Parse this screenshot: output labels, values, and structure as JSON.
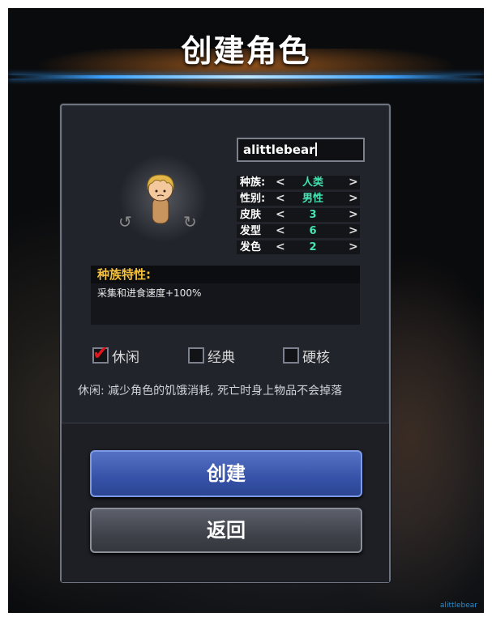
{
  "title": "创建角色",
  "character": {
    "name": "alittlebear",
    "attributes": [
      {
        "label": "种族:",
        "value": "人类"
      },
      {
        "label": "性别:",
        "value": "男性"
      },
      {
        "label": "皮肤",
        "value": "3"
      },
      {
        "label": "发型",
        "value": "6"
      },
      {
        "label": "发色",
        "value": "2"
      }
    ]
  },
  "trait": {
    "heading": "种族特性:",
    "description": "采集和进食速度+100%"
  },
  "modes": [
    {
      "label": "休闲",
      "checked": true
    },
    {
      "label": "经典",
      "checked": false
    },
    {
      "label": "硬核",
      "checked": false
    }
  ],
  "mode_description": "休闲: 减少角色的饥饿消耗, 死亡时身上物品不会掉落",
  "buttons": {
    "create": "创建",
    "back": "返回"
  },
  "watermark": "alittlebear",
  "colors": {
    "value_text": "#44e3b0",
    "trait_heading": "#f4c03a",
    "check": "#e0161c",
    "create_button": "#3652a8",
    "back_button": "#3f424a"
  }
}
